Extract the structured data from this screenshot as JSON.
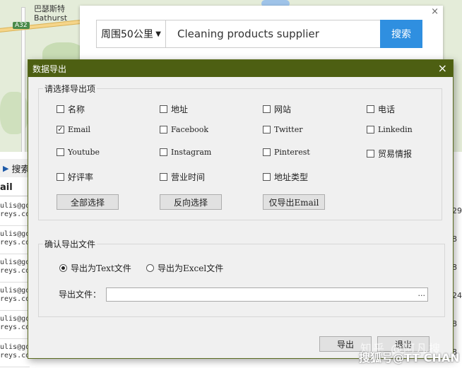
{
  "map": {
    "town_name_cn": "巴瑟斯特",
    "town_name_en": "Bathurst",
    "road_label": "A32"
  },
  "search": {
    "radius": "周围50公里",
    "keyword": "Cleaning products supplier",
    "button": "搜索",
    "close": "×"
  },
  "background": {
    "toolbar_label": "搜索",
    "column_header": "ail",
    "rows": [
      {
        "line1": "ulis@go",
        "line2": "reys.co",
        "right": "29"
      },
      {
        "line1": "ulis@go",
        "line2": "reys.co",
        "right": "8"
      },
      {
        "line1": "ulis@go",
        "line2": "reys.co",
        "right": "8"
      },
      {
        "line1": "ulis@go",
        "line2": "reys.co",
        "right": "24"
      },
      {
        "line1": "ulis@go",
        "line2": "reys.co",
        "right": "8"
      },
      {
        "line1": "ulis@go",
        "line2": "reys.co",
        "right": "8"
      }
    ]
  },
  "dialog": {
    "title": "数据导出",
    "close": "×",
    "export_fields_title": "请选择导出项",
    "fields": [
      {
        "label": "名称",
        "checked": false
      },
      {
        "label": "地址",
        "checked": false
      },
      {
        "label": "网站",
        "checked": false
      },
      {
        "label": "电话",
        "checked": false
      },
      {
        "label": "Email",
        "checked": true
      },
      {
        "label": "Facebook",
        "checked": false
      },
      {
        "label": "Twitter",
        "checked": false
      },
      {
        "label": "Linkedin",
        "checked": false
      },
      {
        "label": "Youtube",
        "checked": false
      },
      {
        "label": "Instagram",
        "checked": false
      },
      {
        "label": "Pinterest",
        "checked": false
      },
      {
        "label": "贸易情报",
        "checked": false
      },
      {
        "label": "好评率",
        "checked": false
      },
      {
        "label": "营业时间",
        "checked": false
      },
      {
        "label": "地址类型",
        "checked": false
      }
    ],
    "select_all": "全部选择",
    "invert_select": "反向选择",
    "email_only": "仅导出Email",
    "confirm_title": "确认导出文件",
    "export_text": "导出为Text文件",
    "export_excel": "导出为Excel文件",
    "export_format_selected": "text",
    "file_label": "导出文件：",
    "file_value": "",
    "browse": "...",
    "export_button": "导出",
    "exit_button": "退出"
  },
  "watermark": {
    "line1": "知乎 @阿凡搜",
    "line2": "搜狐号@TT CHAN"
  }
}
